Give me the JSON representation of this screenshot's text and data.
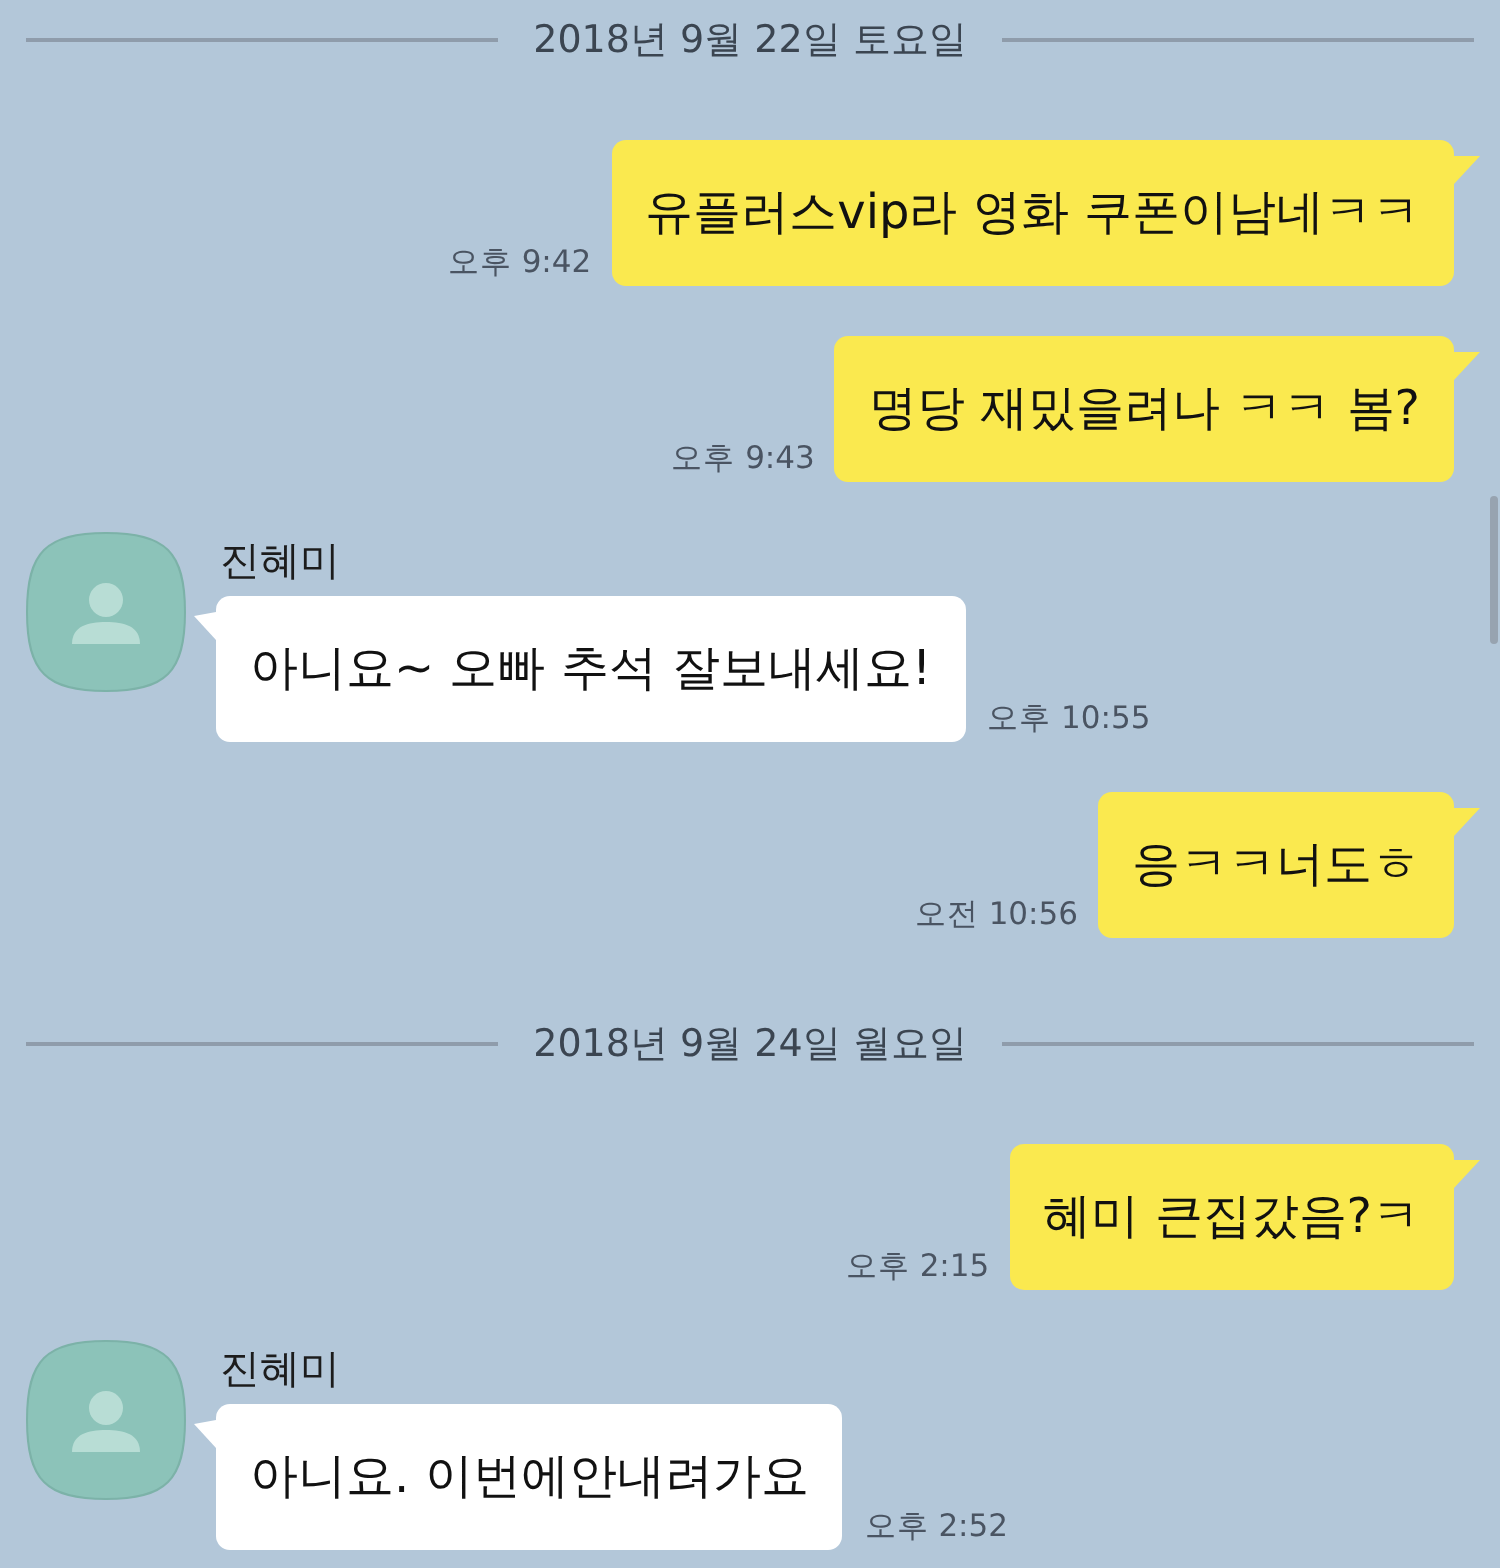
{
  "messages": [
    {
      "kind": "date",
      "text": "2018년 9월 22일 토요일"
    },
    {
      "kind": "sent",
      "text": "유플러스vip라 영화 쿠폰이남네ㅋㅋ",
      "time": "오후 9:42"
    },
    {
      "kind": "sent",
      "text": "명당 재밌을려나 ㅋㅋ 봄?",
      "time": "오후 9:43"
    },
    {
      "kind": "received",
      "sender": "진혜미",
      "text": "아니요~ 오빠 추석 잘보내세요!",
      "time": "오후 10:55"
    },
    {
      "kind": "sent",
      "text": "응ㅋㅋ너도ㅎ",
      "time": "오전 10:56"
    },
    {
      "kind": "date",
      "text": "2018년 9월 24일 월요일"
    },
    {
      "kind": "sent",
      "text": "혜미 큰집갔음?ㅋ",
      "time": "오후 2:15"
    },
    {
      "kind": "received",
      "sender": "진혜미",
      "text": "아니요. 이번에안내려가요",
      "time": "오후 2:52"
    }
  ]
}
